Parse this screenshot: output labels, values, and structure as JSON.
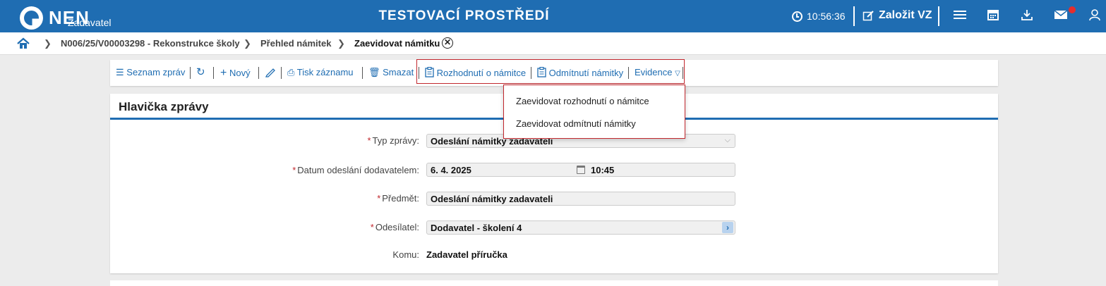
{
  "header": {
    "logo": "NEN",
    "logo_sub": "Zadavatel",
    "env_title": "TESTOVACÍ PROSTŘEDÍ",
    "clock": "10:56:36",
    "new_vz": "Založit VZ",
    "accent": "#1f6db2",
    "icons": [
      "menu-icon",
      "calendar-icon",
      "download-icon",
      "mail-icon",
      "user-icon"
    ]
  },
  "breadcrumb": {
    "items": [
      "N006/25/V00003298 - Rekonstrukce školy",
      "Přehled námitek",
      "Zaevidovat námitku"
    ]
  },
  "toolbar": {
    "list": "Seznam zpráv",
    "new": "Nový",
    "print": "Tisk záznamu",
    "delete": "Smazat",
    "decision": "Rozhodnutí o námitce",
    "rejection": "Odmítnutí námitky",
    "evidence": "Evidence"
  },
  "dropdown": {
    "items": [
      "Zaevidovat rozhodnutí o námitce",
      "Zaevidovat odmítnutí námitky"
    ]
  },
  "form": {
    "title": "Hlavička zprávy",
    "type_label": "Typ zprávy:",
    "type_value": "Odeslání námitky zadavateli",
    "date_label": "Datum odeslání dodavatelem:",
    "date_value": "6. 4. 2025",
    "time_value": "10:45",
    "subject_label": "Předmět:",
    "subject_value": "Odeslání námitky zadavateli",
    "sender_label": "Odesílatel:",
    "sender_value": "Dodavatel - školení 4",
    "to_label": "Komu:",
    "to_value": "Zadavatel příručka",
    "required_mark": "*"
  }
}
